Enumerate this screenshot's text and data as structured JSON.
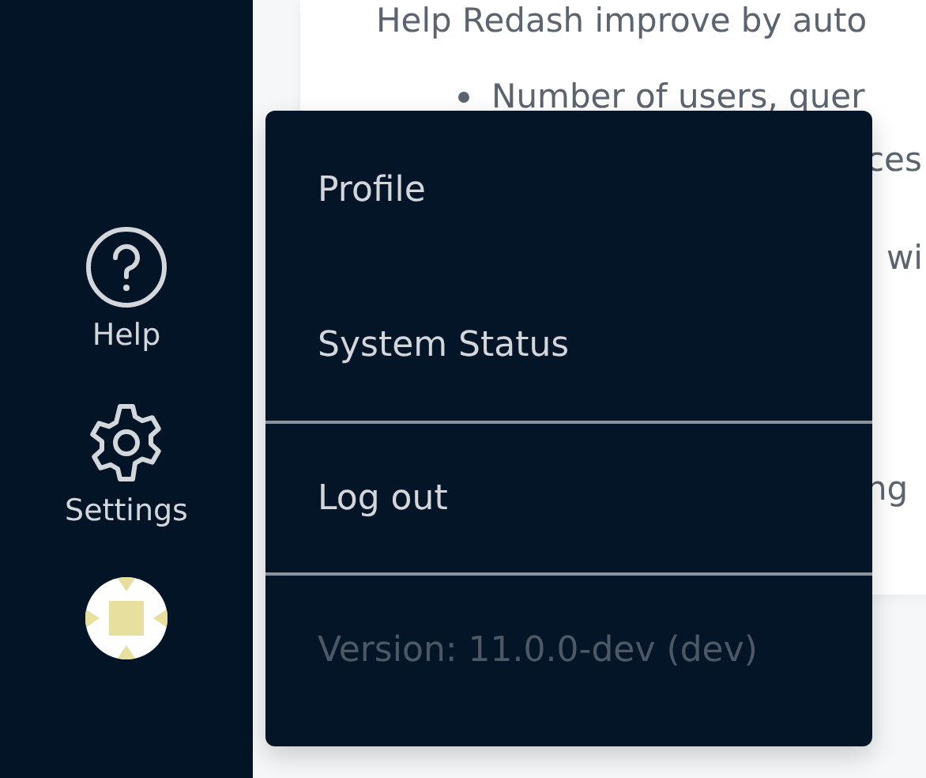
{
  "sidebar": {
    "items": [
      {
        "kind": "help",
        "label": "Help"
      },
      {
        "kind": "settings",
        "label": "Settings"
      },
      {
        "kind": "avatar"
      }
    ]
  },
  "content": {
    "intro": "Help Redash improve by auto",
    "bullet": "Number of users, quer",
    "fragments": [
      "ces",
      "wi",
      "ng"
    ]
  },
  "menu": {
    "items": [
      {
        "label": "Profile"
      },
      {
        "label": "System Status"
      }
    ],
    "logout": "Log out",
    "version": "Version: 11.0.0-dev (dev)"
  }
}
